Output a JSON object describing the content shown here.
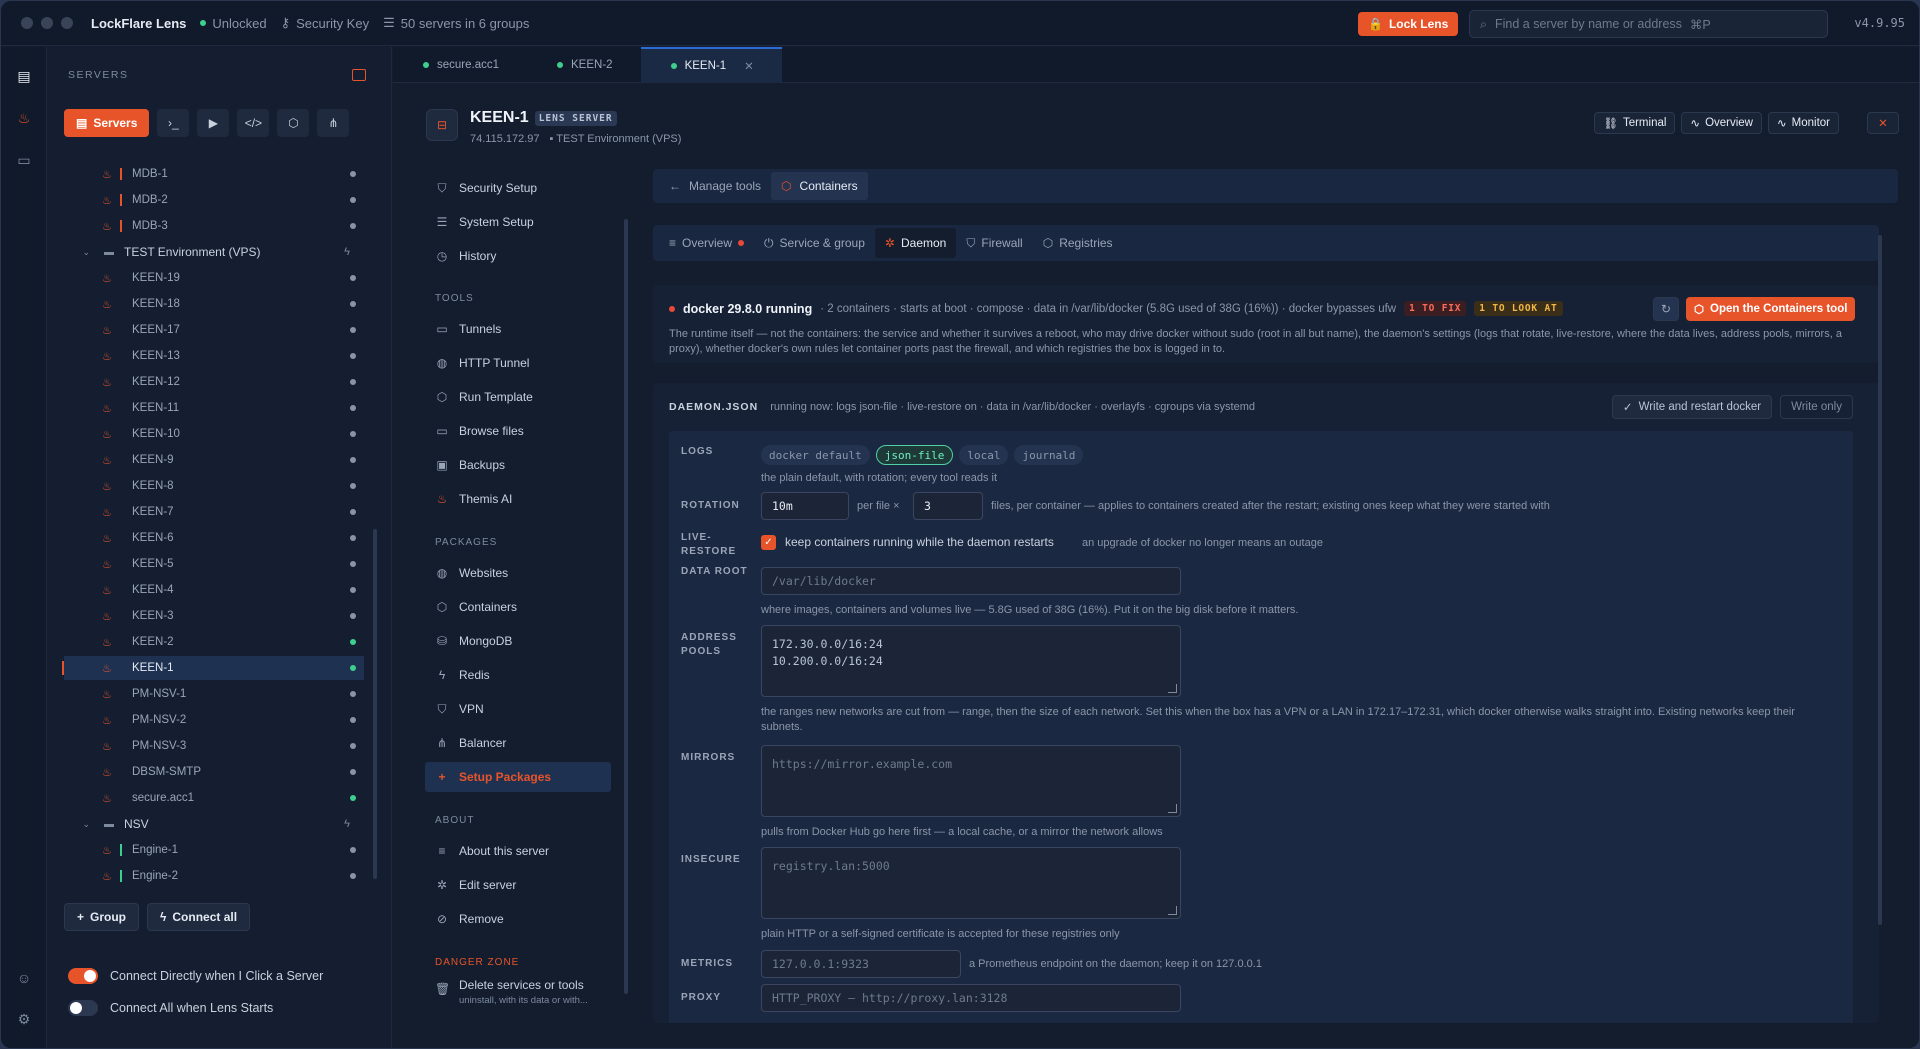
{
  "titlebar": {
    "app_name": "LockFlare Lens",
    "status": "Unlocked",
    "security_key": "Security Key",
    "servers_summary": "50 servers in 6 groups",
    "lock_button": "Lock Lens",
    "search_placeholder": "Find a server by name or address",
    "search_shortcut": "⌘P",
    "version": "v4.9.95"
  },
  "sidebar": {
    "title": "SERVERS",
    "servers_tab": "Servers",
    "tree": [
      {
        "label": "MDB-1",
        "kind": "server",
        "bar": "#e8542a",
        "status": "#8a94a6"
      },
      {
        "label": "MDB-2",
        "kind": "server",
        "bar": "#e8542a",
        "status": "#8a94a6"
      },
      {
        "label": "MDB-3",
        "kind": "server",
        "bar": "#e8542a",
        "status": "#8a94a6"
      },
      {
        "label": "TEST Environment (VPS)",
        "kind": "group"
      },
      {
        "label": "KEEN-19",
        "kind": "server",
        "status": "#8a94a6"
      },
      {
        "label": "KEEN-18",
        "kind": "server",
        "status": "#8a94a6"
      },
      {
        "label": "KEEN-17",
        "kind": "server",
        "status": "#8a94a6"
      },
      {
        "label": "KEEN-13",
        "kind": "server",
        "status": "#8a94a6"
      },
      {
        "label": "KEEN-12",
        "kind": "server",
        "status": "#8a94a6"
      },
      {
        "label": "KEEN-11",
        "kind": "server",
        "status": "#8a94a6"
      },
      {
        "label": "KEEN-10",
        "kind": "server",
        "status": "#8a94a6"
      },
      {
        "label": "KEEN-9",
        "kind": "server",
        "status": "#8a94a6"
      },
      {
        "label": "KEEN-8",
        "kind": "server",
        "status": "#8a94a6"
      },
      {
        "label": "KEEN-7",
        "kind": "server",
        "status": "#8a94a6"
      },
      {
        "label": "KEEN-6",
        "kind": "server",
        "status": "#8a94a6"
      },
      {
        "label": "KEEN-5",
        "kind": "server",
        "status": "#8a94a6"
      },
      {
        "label": "KEEN-4",
        "kind": "server",
        "status": "#8a94a6"
      },
      {
        "label": "KEEN-3",
        "kind": "server",
        "status": "#8a94a6"
      },
      {
        "label": "KEEN-2",
        "kind": "server",
        "status": "#3ecf8e"
      },
      {
        "label": "KEEN-1",
        "kind": "server",
        "status": "#3ecf8e",
        "selected": true
      },
      {
        "label": "PM-NSV-1",
        "kind": "server",
        "status": "#8a94a6"
      },
      {
        "label": "PM-NSV-2",
        "kind": "server",
        "status": "#8a94a6"
      },
      {
        "label": "PM-NSV-3",
        "kind": "server",
        "status": "#8a94a6"
      },
      {
        "label": "DBSM-SMTP",
        "kind": "server",
        "status": "#8a94a6"
      },
      {
        "label": "secure.acc1",
        "kind": "server",
        "status": "#3ecf8e"
      },
      {
        "label": "NSV",
        "kind": "group"
      },
      {
        "label": "Engine-1",
        "kind": "server",
        "bar": "#3ecf8e",
        "status": "#8a94a6"
      },
      {
        "label": "Engine-2",
        "kind": "server",
        "bar": "#3ecf8e",
        "status": "#8a94a6"
      }
    ],
    "group_button": "Group",
    "connect_all_button": "Connect all",
    "toggle_direct": "Connect Directly when I Click a Server",
    "toggle_all": "Connect All when Lens Starts"
  },
  "tabs": [
    {
      "label": "secure.acc1",
      "active": false
    },
    {
      "label": "KEEN-2",
      "active": false
    },
    {
      "label": "KEEN-1",
      "active": true
    }
  ],
  "server": {
    "name": "KEEN-1",
    "badge": "LENS SERVER",
    "ip": "74.115.172.97",
    "group": "TEST Environment (VPS)",
    "terminal": "Terminal",
    "overview": "Overview",
    "monitor": "Monitor"
  },
  "menu": {
    "items_top": [
      "Security Setup",
      "System Setup",
      "History"
    ],
    "tools_title": "TOOLS",
    "tools": [
      "Tunnels",
      "HTTP Tunnel",
      "Run Template",
      "Browse files",
      "Backups",
      "Themis AI"
    ],
    "packages_title": "PACKAGES",
    "packages": [
      "Websites",
      "Containers",
      "MongoDB",
      "Redis",
      "VPN",
      "Balancer",
      "Setup Packages"
    ],
    "about_title": "ABOUT",
    "about": [
      "About this server",
      "Edit server",
      "Remove"
    ],
    "danger_title": "DANGER ZONE",
    "danger_item": "Delete services or tools",
    "danger_sub": "uninstall, with its data or with..."
  },
  "breadcrumb": {
    "back": "Manage tools",
    "current": "Containers"
  },
  "subtabs": [
    "Overview",
    "Service & group",
    "Daemon",
    "Firewall",
    "Registries"
  ],
  "runtime": {
    "title": "docker 29.8.0 running",
    "meta": "· 2 containers · starts at boot · compose · data in /var/lib/docker (5.8G used of 38G (16%)) · docker bypasses ufw",
    "tag_fix": "1 TO FIX",
    "tag_look": "1 TO LOOK AT",
    "open_button": "Open the Containers tool",
    "description": "The runtime itself — not the containers: the service and whether it survives a reboot, who may drive docker without sudo (root in all but name), the daemon's settings (logs that rotate, live-restore, where the data lives, address pools, mirrors, a proxy), whether docker's own rules let container ports past the firewall, and which registries the box is logged in to."
  },
  "daemon": {
    "title": "DAEMON.JSON",
    "running": "running now: logs json-file · live-restore on · data in /var/lib/docker · overlayfs · cgroups via systemd",
    "write_restart": "Write and restart docker",
    "write_only": "Write only",
    "logs_label": "LOGS",
    "log_options": [
      "docker default",
      "json-file",
      "local",
      "journald"
    ],
    "log_selected": "json-file",
    "logs_hint": "the plain default, with rotation; every tool reads it",
    "rotation_label": "ROTATION",
    "rotation_size": "10m",
    "per_file": "per file ×",
    "rotation_files": "3",
    "rotation_hint": "files, per container — applies to containers created after the restart; existing ones keep what they were started with",
    "live_label_1": "LIVE-",
    "live_label_2": "RESTORE",
    "live_text": "keep containers running while the daemon restarts",
    "live_hint": "an upgrade of docker no longer means an outage",
    "dataroot_label": "DATA ROOT",
    "dataroot_value": "/var/lib/docker",
    "dataroot_hint": "where images, containers and volumes live — 5.8G used of 38G (16%). Put it on the big disk before it matters.",
    "pools_label_1": "ADDRESS",
    "pools_label_2": "POOLS",
    "pools_line1": "172.30.0.0/16:24",
    "pools_line2": "10.200.0.0/16:24",
    "pools_hint": "the ranges new networks are cut from — range, then the size of each network. Set this when the box has a VPN or a LAN in 172.17–172.31, which docker otherwise walks straight into. Existing networks keep their subnets.",
    "mirrors_label": "MIRRORS",
    "mirrors_placeholder": "https://mirror.example.com",
    "mirrors_hint": "pulls from Docker Hub go here first — a local cache, or a mirror the network allows",
    "insecure_label": "INSECURE",
    "insecure_placeholder": "registry.lan:5000",
    "insecure_hint": "plain HTTP or a self-signed certificate is accepted for these registries only",
    "metrics_label": "METRICS",
    "metrics_placeholder": "127.0.0.1:9323",
    "metrics_hint": "a Prometheus endpoint on the daemon; keep it on 127.0.0.1",
    "proxy_label": "PROXY",
    "proxy_placeholder": "HTTP_PROXY — http://proxy.lan:3128"
  }
}
